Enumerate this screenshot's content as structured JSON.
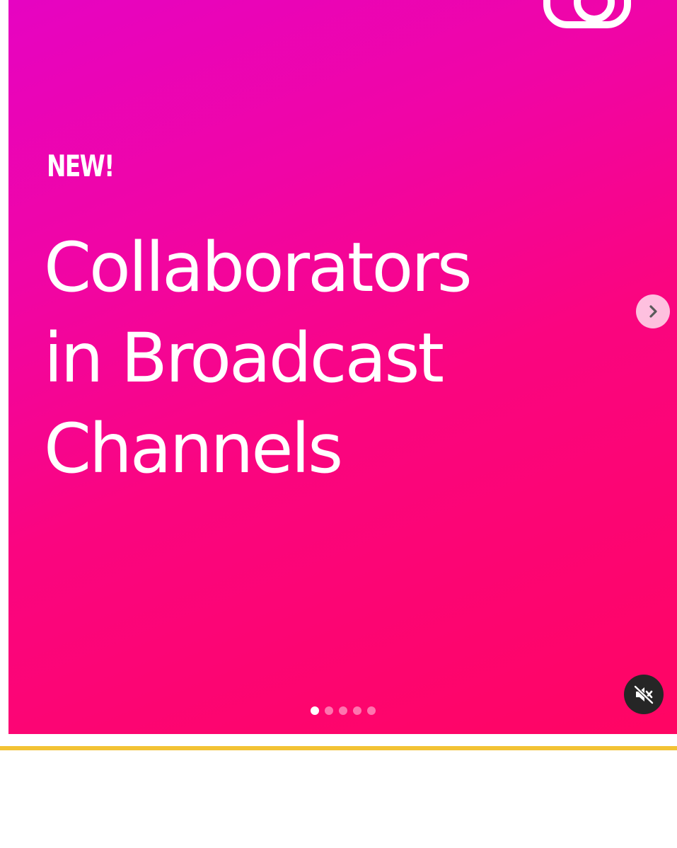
{
  "post": {
    "badge": "NEW!",
    "headline_lines": [
      "Collaborators",
      "in Broadcast",
      "Channels"
    ],
    "carousel": {
      "total_slides": 5,
      "active_index": 0
    },
    "controls": {
      "next_icon": "chevron-right-icon",
      "mute_icon": "speaker-muted-icon",
      "audio_muted": true
    }
  },
  "colors": {
    "gradient_top": "#e604c2",
    "gradient_bottom": "#ff0563",
    "divider": "#f3c334",
    "mute_button_bg": "#262626"
  }
}
